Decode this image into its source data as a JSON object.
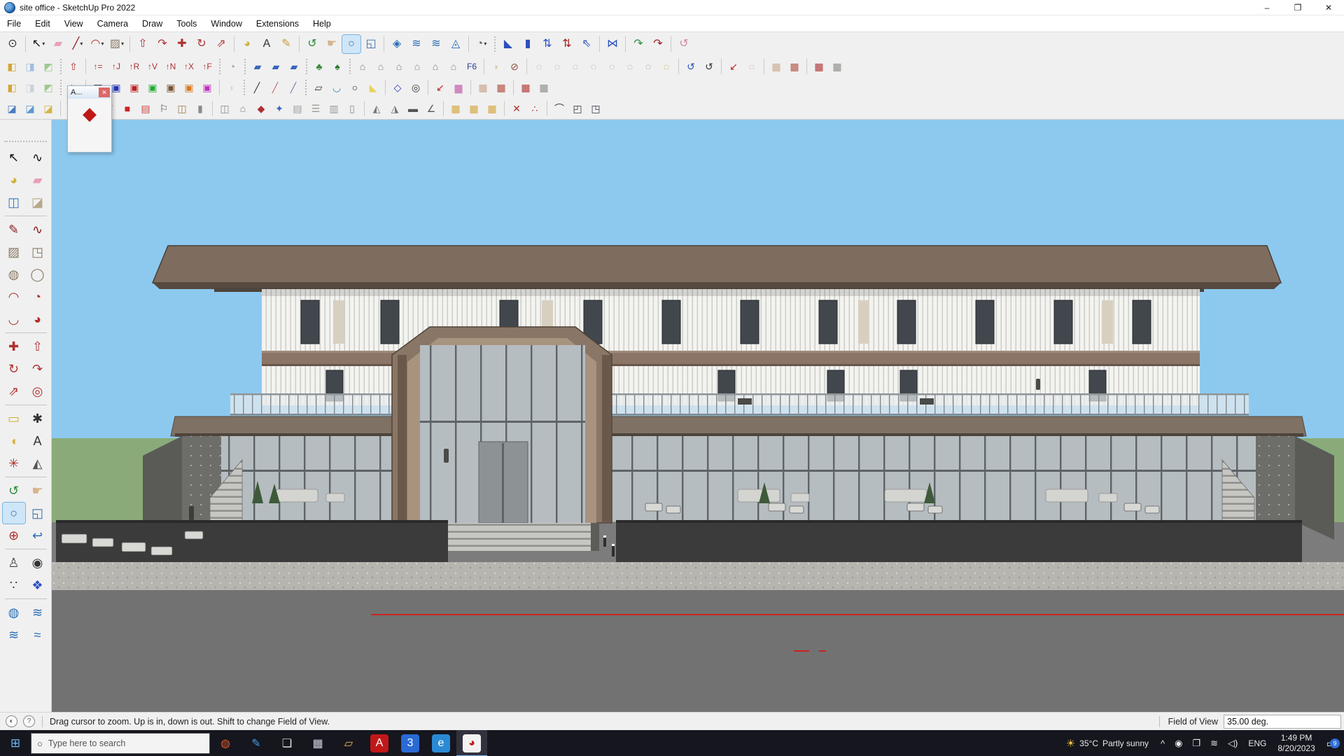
{
  "window": {
    "title": "site office - SketchUp Pro 2022",
    "minimize": "–",
    "maximize": "❐",
    "close": "✕"
  },
  "menu": {
    "items": [
      "File",
      "Edit",
      "View",
      "Camera",
      "Draw",
      "Tools",
      "Window",
      "Extensions",
      "Help"
    ]
  },
  "toolbars": {
    "row1": [
      {
        "n": "zoom-tool",
        "g": "⊙",
        "c": "#333"
      },
      {
        "sep": true
      },
      {
        "n": "select",
        "g": "↖",
        "c": "#111",
        "dd": true
      },
      {
        "n": "eraser",
        "g": "▰",
        "c": "#e8a0b4"
      },
      {
        "n": "line",
        "g": "╱",
        "c": "#8a1a1a",
        "dd": true
      },
      {
        "n": "arc",
        "g": "◠",
        "c": "#b03030",
        "dd": true
      },
      {
        "n": "rectangle",
        "g": "▨",
        "c": "#8a7a66",
        "dd": true
      },
      {
        "sep": true
      },
      {
        "n": "push-pull",
        "g": "⇧",
        "c": "#b03030"
      },
      {
        "n": "follow-me",
        "g": "↷",
        "c": "#b03030"
      },
      {
        "n": "move",
        "g": "✚",
        "c": "#b03030"
      },
      {
        "n": "rotate",
        "g": "↻",
        "c": "#b03030"
      },
      {
        "n": "scale",
        "g": "⇗",
        "c": "#b03030"
      },
      {
        "sep": true
      },
      {
        "n": "paint-bucket",
        "g": "◕",
        "c": "#d4b23a"
      },
      {
        "n": "3d-text",
        "g": "A",
        "c": "#333"
      },
      {
        "n": "label",
        "g": "✎",
        "c": "#c89a3a"
      },
      {
        "sep": true
      },
      {
        "n": "orbit",
        "g": "↺",
        "c": "#2a8a3a"
      },
      {
        "n": "pan",
        "g": "☛",
        "c": "#d9b38c"
      },
      {
        "n": "zoom",
        "g": "○",
        "c": "#3a6ea8",
        "b": "#cfe6f8"
      },
      {
        "n": "zoom-window",
        "g": "◱",
        "c": "#3a6ea8"
      },
      {
        "sep": true
      },
      {
        "n": "match-photo",
        "g": "◈",
        "c": "#2a6db5"
      },
      {
        "n": "previous-view",
        "g": "≋",
        "c": "#2a6db5"
      },
      {
        "n": "next-view",
        "g": "≋",
        "c": "#2a6db5"
      },
      {
        "n": "standard-views",
        "g": "◬",
        "c": "#2a6db5"
      },
      {
        "sep": true
      },
      {
        "n": "avatar",
        "g": "◔",
        "c": "#666",
        "dd": true
      },
      {
        "sep": "dot"
      },
      {
        "n": "walk-tool",
        "g": "◣",
        "c": "#2a4fc0"
      },
      {
        "n": "stand-tool",
        "g": "▮",
        "c": "#2a4fc0"
      },
      {
        "n": "up-down",
        "g": "⇅",
        "c": "#2a4fc0"
      },
      {
        "n": "down-up",
        "g": "⇅",
        "c": "#a02020"
      },
      {
        "n": "fly",
        "g": "⇖",
        "c": "#2a4fc0"
      },
      {
        "sep": true
      },
      {
        "n": "bowtie-view",
        "g": "⋈",
        "c": "#2a4fc0"
      },
      {
        "sep": true
      },
      {
        "n": "turn-left",
        "g": "↷",
        "c": "#2a8a3a"
      },
      {
        "n": "turn-right",
        "g": "↷",
        "c": "#a02020"
      },
      {
        "sep": true
      },
      {
        "n": "roll-camera",
        "g": "↺",
        "c": "#d08aa0"
      }
    ],
    "row2": [
      {
        "n": "box-gold",
        "g": "◧",
        "c": "#d4a437"
      },
      {
        "n": "box-blue",
        "g": "◨",
        "c": "#9fc0e0"
      },
      {
        "n": "box-green",
        "g": "◩",
        "c": "#9fc98f"
      },
      {
        "sep": "dot"
      },
      {
        "n": "push-line",
        "g": "⇧",
        "c": "#b03030"
      },
      {
        "sep": true
      },
      {
        "n": "arrow-eq",
        "g": "↑=",
        "c": "#b03030"
      },
      {
        "n": "arrow-j",
        "g": "↑J",
        "c": "#b03030"
      },
      {
        "n": "arrow-r",
        "g": "↑R",
        "c": "#b03030"
      },
      {
        "n": "arrow-v",
        "g": "↑V",
        "c": "#b03030"
      },
      {
        "n": "arrow-n",
        "g": "↑N",
        "c": "#b03030"
      },
      {
        "n": "arrow-x",
        "g": "↑X",
        "c": "#b03030"
      },
      {
        "n": "arrow-f",
        "g": "↑F",
        "c": "#b03030"
      },
      {
        "sep": "dot"
      },
      {
        "n": "fan-fold",
        "g": "◔",
        "c": "#9a9a96"
      },
      {
        "sep": "dot"
      },
      {
        "n": "sketch-plane-1",
        "g": "▰",
        "c": "#3a66b8"
      },
      {
        "n": "sketch-plane-2",
        "g": "▰",
        "c": "#3a66b8"
      },
      {
        "n": "sketch-plane-3",
        "g": "▰",
        "c": "#3a66b8"
      },
      {
        "sep": "dot"
      },
      {
        "n": "tree-proxy",
        "g": "♣",
        "c": "#3a8a3a"
      },
      {
        "n": "tree-render",
        "g": "♠",
        "c": "#2f7a2f"
      },
      {
        "sep": "dot"
      },
      {
        "n": "house-gable",
        "g": "⌂",
        "c": "#7d7d79"
      },
      {
        "n": "house-hip",
        "g": "⌂",
        "c": "#8a8a85"
      },
      {
        "n": "house-flat",
        "g": "⌂",
        "c": "#7d7d79"
      },
      {
        "n": "house-shed",
        "g": "⌂",
        "c": "#8a8a85"
      },
      {
        "n": "house-dormer",
        "g": "⌂",
        "c": "#7d7d79"
      },
      {
        "n": "house-tower",
        "g": "⌂",
        "c": "#8a8a85"
      },
      {
        "n": "f6-script",
        "g": "F6",
        "c": "#2a3a9a"
      },
      {
        "sep": true
      },
      {
        "n": "dome-tan",
        "g": "◗",
        "c": "#d9c9a8"
      },
      {
        "n": "pencil-circle",
        "g": "⊘",
        "c": "#8a4a3a"
      },
      {
        "sep": true
      },
      {
        "n": "loop-1",
        "g": "◌",
        "c": "#9a9a96"
      },
      {
        "n": "loop-2",
        "g": "◌",
        "c": "#9a9a96"
      },
      {
        "n": "loop-3",
        "g": "◌",
        "c": "#9a9a96"
      },
      {
        "n": "loop-4",
        "g": "◌",
        "c": "#9a9a96"
      },
      {
        "n": "loop-5",
        "g": "◌",
        "c": "#9a9a96"
      },
      {
        "n": "loop-6",
        "g": "◌",
        "c": "#9a9a96"
      },
      {
        "n": "loop-7",
        "g": "◌",
        "c": "#85857f"
      },
      {
        "n": "loop-yellow",
        "g": "◌",
        "c": "#b8a030"
      },
      {
        "sep": true
      },
      {
        "n": "loop-blue",
        "g": "↺",
        "c": "#2a4fc0"
      },
      {
        "n": "loop-dark",
        "g": "↺",
        "c": "#333"
      },
      {
        "sep": true
      },
      {
        "n": "arrow-sw-red",
        "g": "↙",
        "c": "#c02020"
      },
      {
        "n": "loop-pink",
        "g": "◌",
        "c": "#d090c0"
      },
      {
        "sep": true
      },
      {
        "n": "grid-tan",
        "g": "▦",
        "c": "#c8a890"
      },
      {
        "n": "grid-red",
        "g": "▦",
        "c": "#b05040"
      },
      {
        "sep": true
      },
      {
        "n": "mesh-red",
        "g": "▦",
        "c": "#b03030"
      },
      {
        "n": "mesh-gray",
        "g": "▦",
        "c": "#8a8a86"
      }
    ],
    "row3": [
      {
        "n": "plane-gold",
        "g": "◧",
        "c": "#d4a437"
      },
      {
        "n": "plane-white",
        "g": "◨",
        "c": "#c9d2da"
      },
      {
        "n": "plane-green",
        "g": "◩",
        "c": "#9fc98f"
      },
      {
        "sep": "dot"
      },
      {
        "n": "component-brown",
        "g": "◆",
        "c": "#7a5a3a",
        "dd": true
      },
      {
        "sep": true
      },
      {
        "n": "box-black",
        "g": "▣",
        "c": "#2a2a2a"
      },
      {
        "n": "box-blue-dark",
        "g": "▣",
        "c": "#2233bb"
      },
      {
        "n": "box-red",
        "g": "▣",
        "c": "#bb2222"
      },
      {
        "n": "box-green-bright",
        "g": "▣",
        "c": "#22aa33"
      },
      {
        "n": "box-brown",
        "g": "▣",
        "c": "#7a5230"
      },
      {
        "n": "box-orange",
        "g": "▣",
        "c": "#d97820"
      },
      {
        "n": "box-magenta",
        "g": "▣",
        "c": "#bb33bb"
      },
      {
        "sep": true
      },
      {
        "n": "leaf-white",
        "g": "◗",
        "c": "#d8d8d2"
      },
      {
        "sep": "dot"
      },
      {
        "n": "pen-line",
        "g": "╱",
        "c": "#333"
      },
      {
        "n": "pen-hatch-red",
        "g": "╱",
        "c": "#c06a6a"
      },
      {
        "n": "pen-hatch-blue",
        "g": "╱",
        "c": "#6a7ac0"
      },
      {
        "sep": "dot"
      },
      {
        "n": "trapezoid",
        "g": "▱",
        "c": "#333"
      },
      {
        "n": "arc-blue",
        "g": "◡",
        "c": "#2a8ab5"
      },
      {
        "n": "ring-black",
        "g": "○",
        "c": "#222"
      },
      {
        "n": "cone-yellow",
        "g": "◣",
        "c": "#e8d45a"
      },
      {
        "sep": true
      },
      {
        "n": "pentagon-blue",
        "g": "◇",
        "c": "#2233bb"
      },
      {
        "n": "spiral",
        "g": "◎",
        "c": "#333"
      },
      {
        "sep": true
      },
      {
        "n": "arrow-red-big",
        "g": "↙",
        "c": "#c02020"
      },
      {
        "n": "brush-pink",
        "g": "▆",
        "c": "#d08ac0"
      },
      {
        "sep": true
      },
      {
        "n": "grid-skin",
        "g": "▦",
        "c": "#c8a188"
      },
      {
        "n": "grid-red-edge",
        "g": "▦",
        "c": "#b04838"
      },
      {
        "sep": true
      },
      {
        "n": "mesh-arrows",
        "g": "▦",
        "c": "#b03030"
      },
      {
        "n": "mesh-stack",
        "g": "▦",
        "c": "#8a8a86"
      }
    ],
    "row4": [
      {
        "n": "terrain-hash",
        "g": "◪",
        "c": "#4a7ac0"
      },
      {
        "n": "terrain-blue",
        "g": "◪",
        "c": "#5a9ad0"
      },
      {
        "n": "terrain-gold",
        "g": "◪",
        "c": "#d4b44a"
      },
      {
        "sep": true
      },
      {
        "n": "roof-red",
        "g": "◢",
        "c": "#c04040"
      },
      {
        "n": "grid-white",
        "g": "▦",
        "c": "#c9c9c4"
      },
      {
        "n": "swirl-orange",
        "g": "↺",
        "c": "#d07820"
      },
      {
        "n": "square-red",
        "g": "■",
        "c": "#cc2222"
      },
      {
        "n": "stripe-rect",
        "g": "▤",
        "c": "#cc4444"
      },
      {
        "n": "flag-white",
        "g": "⚐",
        "c": "#444"
      },
      {
        "n": "elbow-brown",
        "g": "◫",
        "c": "#9a7a4a"
      },
      {
        "n": "pipe-gray",
        "g": "▮",
        "c": "#8a8a86"
      },
      {
        "sep": true
      },
      {
        "n": "joint-box",
        "g": "◫",
        "c": "#8a8a86"
      },
      {
        "n": "house-tool",
        "g": "⌂",
        "c": "#7d7d79"
      },
      {
        "n": "component-red-tool",
        "g": "◆",
        "c": "#b03030"
      },
      {
        "n": "spray-blue",
        "g": "✦",
        "c": "#3a66b8"
      },
      {
        "n": "stair-tool",
        "g": "▤",
        "c": "#9a9a96"
      },
      {
        "n": "fence-tool",
        "g": "☰",
        "c": "#9a9a96"
      },
      {
        "n": "wall-tool",
        "g": "▥",
        "c": "#9a9a96"
      },
      {
        "n": "pillar-tool",
        "g": "▯",
        "c": "#8a8a86"
      },
      {
        "sep": true
      },
      {
        "n": "truss-1",
        "g": "◭",
        "c": "#777"
      },
      {
        "n": "truss-2",
        "g": "◮",
        "c": "#777"
      },
      {
        "n": "beam-dark",
        "g": "▬",
        "c": "#555"
      },
      {
        "n": "angle-tool",
        "g": "∠",
        "c": "#555"
      },
      {
        "sep": true
      },
      {
        "n": "grid-gold-1",
        "g": "▦",
        "c": "#d4a437"
      },
      {
        "n": "grid-gold-2",
        "g": "▦",
        "c": "#d4a437"
      },
      {
        "n": "grid-gold-3",
        "g": "▦",
        "c": "#d4a437"
      },
      {
        "sep": true
      },
      {
        "n": "scatter-points-1",
        "g": "✕",
        "c": "#b03030"
      },
      {
        "n": "scatter-points-2",
        "g": "∴",
        "c": "#b03030"
      },
      {
        "sep": true
      },
      {
        "n": "curve-path",
        "g": "⌒",
        "c": "#333"
      },
      {
        "n": "box-pair",
        "g": "◰",
        "c": "#334"
      },
      {
        "n": "box-pair-2",
        "g": "◳",
        "c": "#334"
      }
    ]
  },
  "mini_panel": {
    "title": "A...",
    "close": "✕",
    "icon": {
      "n": "red-gem-component",
      "g": "◆",
      "c": "#c01818"
    }
  },
  "left_toolbar": {
    "items": [
      {
        "n": "select",
        "g": "↖",
        "c": "#111"
      },
      {
        "n": "lasso",
        "g": "∿",
        "c": "#111"
      },
      {
        "n": "paint-bucket",
        "g": "◕",
        "c": "#d4b23a"
      },
      {
        "n": "eraser",
        "g": "▰",
        "c": "#e8a0b4"
      },
      {
        "n": "component",
        "g": "◫",
        "c": "#3a7ac0"
      },
      {
        "n": "make-component",
        "g": "◪",
        "c": "#b8a88a"
      },
      {
        "hr": true
      },
      {
        "n": "line",
        "g": "✎",
        "c": "#8a1a1a"
      },
      {
        "n": "freehand",
        "g": "∿",
        "c": "#8a1a1a"
      },
      {
        "n": "rectangle",
        "g": "▨",
        "c": "#8a7a66"
      },
      {
        "n": "rotated-rectangle",
        "g": "◳",
        "c": "#8a7a66"
      },
      {
        "n": "circle",
        "g": "◍",
        "c": "#8a7a66"
      },
      {
        "n": "polygon",
        "g": "◯",
        "c": "#8a7a66"
      },
      {
        "n": "arc",
        "g": "◠",
        "c": "#b03030"
      },
      {
        "n": "two-point-arc",
        "g": "◔",
        "c": "#b03030"
      },
      {
        "n": "three-point-arc",
        "g": "◡",
        "c": "#b03030"
      },
      {
        "n": "pie",
        "g": "◕",
        "c": "#b03030"
      },
      {
        "hr": true
      },
      {
        "n": "move",
        "g": "✚",
        "c": "#b03030"
      },
      {
        "n": "push-pull",
        "g": "⇧",
        "c": "#b03030"
      },
      {
        "n": "rotate",
        "g": "↻",
        "c": "#b03030"
      },
      {
        "n": "follow-me",
        "g": "↷",
        "c": "#b03030"
      },
      {
        "n": "scale",
        "g": "⇗",
        "c": "#b03030"
      },
      {
        "n": "offset",
        "g": "◎",
        "c": "#b03030"
      },
      {
        "hr": true
      },
      {
        "n": "tape-measure",
        "g": "▭",
        "c": "#d4b23a"
      },
      {
        "n": "dimension",
        "g": "✱",
        "c": "#333"
      },
      {
        "n": "protractor",
        "g": "◖",
        "c": "#d4b23a"
      },
      {
        "n": "text",
        "g": "A",
        "c": "#333"
      },
      {
        "n": "axes",
        "g": "✳",
        "c": "#b03030"
      },
      {
        "n": "3d-text",
        "g": "◭",
        "c": "#555"
      },
      {
        "hr": true
      },
      {
        "n": "orbit",
        "g": "↺",
        "c": "#2a8a3a"
      },
      {
        "n": "pan",
        "g": "☛",
        "c": "#d9b38c"
      },
      {
        "n": "zoom",
        "g": "○",
        "c": "#3a6ea8",
        "b": "#cfe6f8"
      },
      {
        "n": "zoom-window",
        "g": "◱",
        "c": "#3a6ea8"
      },
      {
        "n": "zoom-extents",
        "g": "⊕",
        "c": "#b03030"
      },
      {
        "n": "zoom-previous",
        "g": "↩",
        "c": "#2a6db5"
      },
      {
        "hr": true
      },
      {
        "n": "position-camera",
        "g": "♙",
        "c": "#444"
      },
      {
        "n": "look-around",
        "g": "◉",
        "c": "#333"
      },
      {
        "n": "walk",
        "g": "∵",
        "c": "#333"
      },
      {
        "n": "move-camera",
        "g": "❖",
        "c": "#2a4fc0"
      },
      {
        "hr": true
      },
      {
        "n": "section-plane",
        "g": "◍",
        "c": "#2a6db5"
      },
      {
        "n": "section-display",
        "g": "≋",
        "c": "#2a6db5"
      },
      {
        "n": "section-fill",
        "g": "≋",
        "c": "#2a6db5"
      },
      {
        "n": "section-cut",
        "g": "≈",
        "c": "#2a6db5"
      }
    ]
  },
  "viewport": {
    "colors": {
      "sky": "#8dc9ef",
      "grass": "#8aab79",
      "pavement": "#7c7c7c",
      "pool": "#3b3b3b",
      "roof": "#7e6d5e",
      "axis_red": "#cc2222"
    }
  },
  "statusbar": {
    "icons": [
      {
        "n": "geolocation",
        "g": "◐"
      },
      {
        "n": "help",
        "g": "?"
      }
    ],
    "message": "Drag cursor to zoom.  Up is in, down is out. Shift to change Field of View.",
    "fov_label": "Field of View",
    "fov_value": "35.00 deg."
  },
  "taskbar": {
    "start": "⊞",
    "search_placeholder": "Type here to search",
    "apps": [
      {
        "n": "paint-ball",
        "g": "◍",
        "c": "#e05a2b"
      },
      {
        "n": "pen-app",
        "g": "✎",
        "c": "#3fa0e8"
      },
      {
        "n": "task-view",
        "g": "❏",
        "c": "#e8e8e8"
      },
      {
        "n": "widgets",
        "g": "▦",
        "c": "#cfd6e4"
      },
      {
        "n": "file-explorer",
        "g": "▱",
        "c": "#e8b64c"
      },
      {
        "n": "adobe-acrobat",
        "g": "A",
        "c": "#ffffff",
        "b": "#c01818"
      },
      {
        "n": "app-3",
        "g": "3",
        "c": "#ffffff",
        "b": "#2a6ad4"
      },
      {
        "n": "edge",
        "g": "e",
        "c": "#ffffff",
        "b": "#2a8ad4"
      },
      {
        "n": "sketchup",
        "g": "◕",
        "c": "#c01818",
        "b": "#f2f2f2",
        "active": true
      }
    ],
    "tray": {
      "weather_icon": "☀",
      "weather_temp": "35°C",
      "weather_text": "Partly sunny",
      "icons": [
        {
          "n": "hidden-icons",
          "g": "^"
        },
        {
          "n": "record",
          "g": "◉"
        },
        {
          "n": "cast",
          "g": "❐"
        },
        {
          "n": "wifi",
          "g": "≋"
        },
        {
          "n": "volume",
          "g": "◁)"
        }
      ],
      "lang": "ENG",
      "time": "1:49 PM",
      "date": "8/20/2023",
      "notif_glyph": "▭",
      "notif_badge": "9"
    }
  }
}
